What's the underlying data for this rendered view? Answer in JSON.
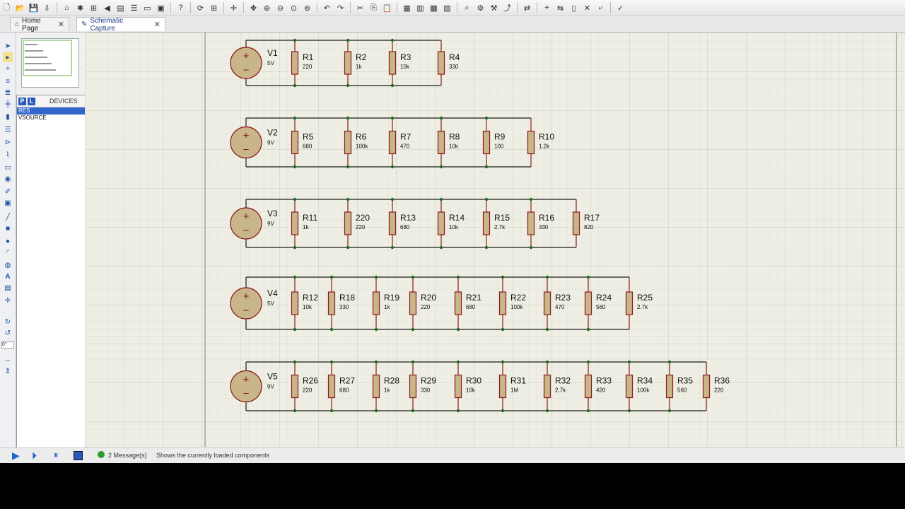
{
  "tabs": [
    {
      "label": "Home Page",
      "active": false
    },
    {
      "label": "Schematic Capture",
      "active": true
    }
  ],
  "device_panel": {
    "p_label": "P",
    "l_label": "L",
    "title": "DEVICES",
    "items": [
      "RES",
      "VSOURCE"
    ],
    "selected": "RES"
  },
  "left_tools": {
    "rotation": "0°"
  },
  "status": {
    "messages": "2 Message(s)",
    "hint": "Shows the currently loaded components"
  },
  "colors": {
    "grid_bg": "#eeeee4",
    "component": "#8b1a1a",
    "resistor_fill": "#c9b58a",
    "wire": "#1a1a1a",
    "node": "#1f6e1f"
  },
  "circuits": [
    {
      "source": {
        "name": "V1",
        "value": "5V"
      },
      "resistors": [
        {
          "name": "R1",
          "value": "220"
        },
        {
          "name": "R2",
          "value": "1k"
        },
        {
          "name": "R3",
          "value": "10k"
        },
        {
          "name": "R4",
          "value": "330"
        }
      ]
    },
    {
      "source": {
        "name": "V2",
        "value": "9V"
      },
      "resistors": [
        {
          "name": "R5",
          "value": "680"
        },
        {
          "name": "R6",
          "value": "100k"
        },
        {
          "name": "R7",
          "value": "470"
        },
        {
          "name": "R8",
          "value": "10k"
        },
        {
          "name": "R9",
          "value": "100"
        },
        {
          "name": "R10",
          "value": "1.2k"
        }
      ]
    },
    {
      "source": {
        "name": "V3",
        "value": "9V"
      },
      "resistors": [
        {
          "name": "R11",
          "value": "1k"
        },
        {
          "name": "220",
          "value": "220"
        },
        {
          "name": "R13",
          "value": "680"
        },
        {
          "name": "R14",
          "value": "10k"
        },
        {
          "name": "R15",
          "value": "2.7k"
        },
        {
          "name": "R16",
          "value": "330"
        },
        {
          "name": "R17",
          "value": "820"
        }
      ]
    },
    {
      "source": {
        "name": "V4",
        "value": "5V"
      },
      "resistors": [
        {
          "name": "R12",
          "value": "10k"
        },
        {
          "name": "R18",
          "value": "330"
        },
        {
          "name": "R19",
          "value": "1k"
        },
        {
          "name": "R20",
          "value": "220"
        },
        {
          "name": "R21",
          "value": "680"
        },
        {
          "name": "R22",
          "value": "100k"
        },
        {
          "name": "R23",
          "value": "470"
        },
        {
          "name": "R24",
          "value": "560"
        },
        {
          "name": "R25",
          "value": "2.7k"
        }
      ]
    },
    {
      "source": {
        "name": "V5",
        "value": "9V"
      },
      "resistors": [
        {
          "name": "R26",
          "value": "220"
        },
        {
          "name": "R27",
          "value": "680"
        },
        {
          "name": "R28",
          "value": "1k"
        },
        {
          "name": "R29",
          "value": "330"
        },
        {
          "name": "R30",
          "value": "10k"
        },
        {
          "name": "R31",
          "value": "1M"
        },
        {
          "name": "R32",
          "value": "2.7k"
        },
        {
          "name": "R33",
          "value": "420"
        },
        {
          "name": "R34",
          "value": "100k"
        },
        {
          "name": "R35",
          "value": "560"
        },
        {
          "name": "R36",
          "value": "220"
        }
      ]
    }
  ]
}
